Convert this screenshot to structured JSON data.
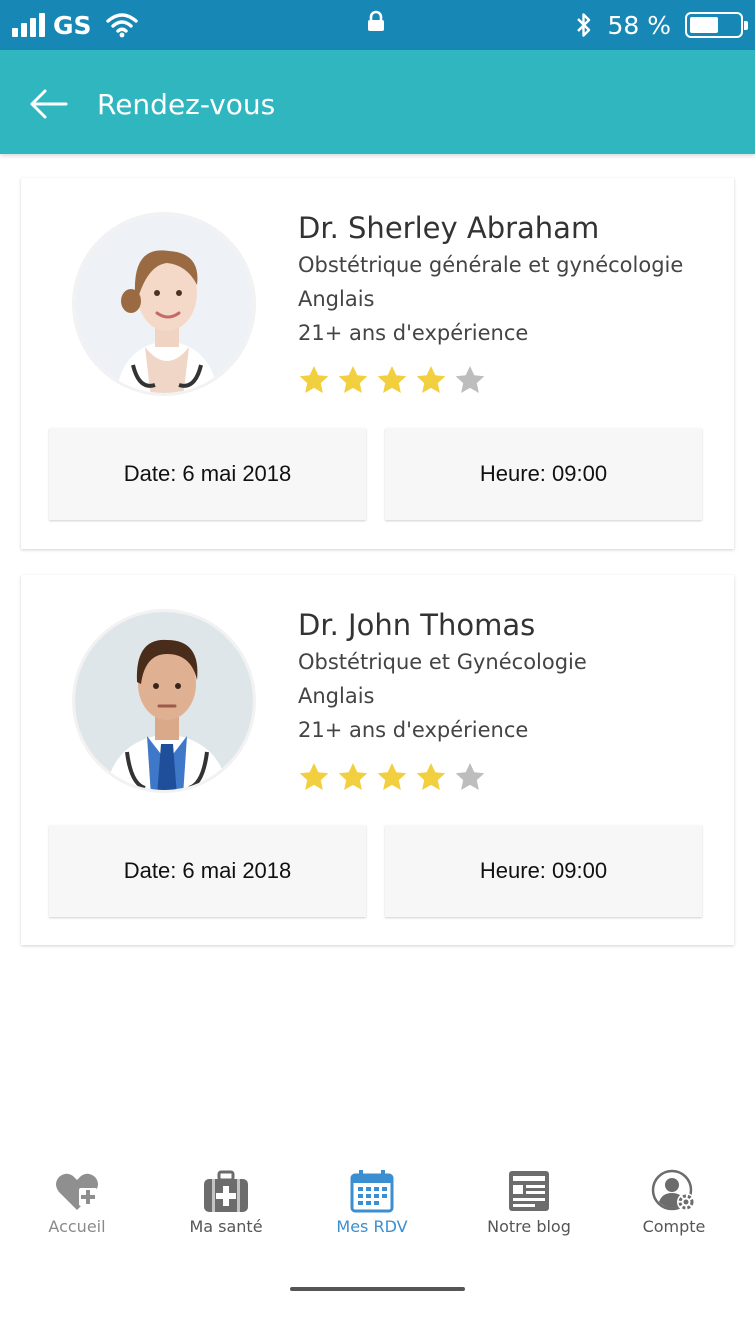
{
  "status_bar": {
    "carrier": "GS",
    "battery_text": "58 %",
    "battery_level": 0.58,
    "icons": [
      "signal-icon",
      "wifi-icon",
      "lock-icon",
      "bluetooth-icon",
      "battery-icon"
    ]
  },
  "header": {
    "title": "Rendez-vous",
    "back_icon": "arrow-left-icon"
  },
  "appointments": [
    {
      "name": "Dr. Sherley Abraham",
      "specialty": "Obstétrique générale et gynécologie",
      "language": "Anglais",
      "experience": "21+ ans d'expérience",
      "rating": 4,
      "rating_max": 5,
      "date": "Date: 6 mai 2018",
      "time": "Heure: 09:00"
    },
    {
      "name": "Dr. John Thomas",
      "specialty": "Obstétrique et Gynécologie",
      "language": "Anglais",
      "experience": "21+ ans d'expérience",
      "rating": 4,
      "rating_max": 5,
      "date": "Date: 6 mai 2018",
      "time": "Heure: 09:00"
    }
  ],
  "bottom_nav": [
    {
      "label": "Accueil",
      "icon": "heart-plus-icon"
    },
    {
      "label": "Ma santé",
      "icon": "medical-kit-icon"
    },
    {
      "label": "Mes RDV",
      "icon": "calendar-icon",
      "active": true
    },
    {
      "label": "Notre blog",
      "icon": "blog-icon"
    },
    {
      "label": "Compte",
      "icon": "account-settings-icon"
    }
  ],
  "colors": {
    "status_bar": "#1788b5",
    "app_bar": "#2fb6bf",
    "star_filled": "#f2cf3f",
    "star_empty": "#bdbdbd",
    "nav_active": "#3b8fd1"
  }
}
